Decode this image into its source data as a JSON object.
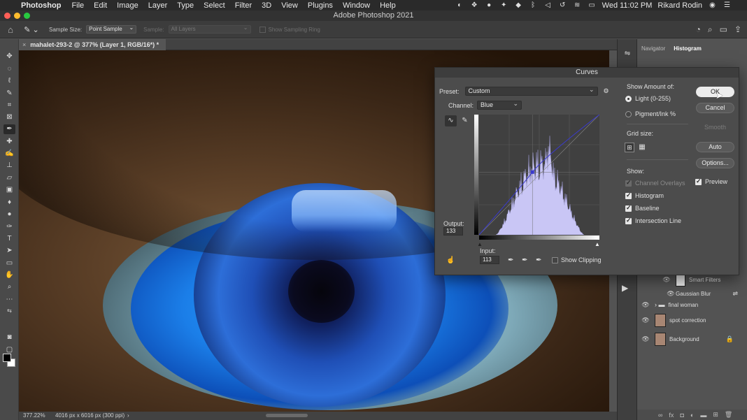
{
  "menubar": {
    "app": "Photoshop",
    "menus": [
      "File",
      "Edit",
      "Image",
      "Layer",
      "Type",
      "Select",
      "Filter",
      "3D",
      "View",
      "Plugins",
      "Window",
      "Help"
    ],
    "clock": "Wed 11:02 PM",
    "user": "Rikard Rodin"
  },
  "window": {
    "title": "Adobe Photoshop 2021"
  },
  "options_bar": {
    "sample_size_label": "Sample Size:",
    "sample_size_value": "Point Sample",
    "sample_label": "Sample:",
    "sample_value": "All Layers",
    "sampling_ring_label": "Show Sampling Ring"
  },
  "document": {
    "tab_title": "mahalet-293-2 @ 377% (Layer 1, RGB/16*) *",
    "zoom": "377.22%",
    "doc_size": "4016 px x 6016 px (300 ppi)"
  },
  "panels": {
    "tabs": [
      "Navigator",
      "Histogram"
    ],
    "active_tab": "Histogram",
    "layers": [
      {
        "name": "Smart Filters",
        "type": "smart-filters"
      },
      {
        "name": "Gaussian Blur",
        "type": "filter"
      },
      {
        "name": "final woman",
        "type": "group"
      },
      {
        "name": "spot correction",
        "type": "layer"
      },
      {
        "name": "Background",
        "type": "background"
      }
    ]
  },
  "curves": {
    "title": "Curves",
    "preset_label": "Preset:",
    "preset_value": "Custom",
    "channel_label": "Channel:",
    "channel_value": "Blue",
    "output_label": "Output:",
    "output_value": "133",
    "input_label": "Input:",
    "input_value": "113",
    "show_clipping_label": "Show Clipping",
    "show_amount_label": "Show Amount of:",
    "light_label": "Light  (0-255)",
    "pigment_label": "Pigment/Ink %",
    "grid_size_label": "Grid size:",
    "show_label": "Show:",
    "channel_overlays_label": "Channel Overlays",
    "histogram_label": "Histogram",
    "baseline_label": "Baseline",
    "intersection_label": "Intersection Line",
    "buttons": {
      "ok": "OK",
      "cancel": "Cancel",
      "smooth": "Smooth",
      "auto": "Auto",
      "options": "Options..."
    },
    "preview_label": "Preview",
    "curve_point": {
      "input": 113,
      "output": 133
    },
    "colors": {
      "curve": "#3a3acc",
      "histogram_fill": "#c9c6f5"
    }
  }
}
